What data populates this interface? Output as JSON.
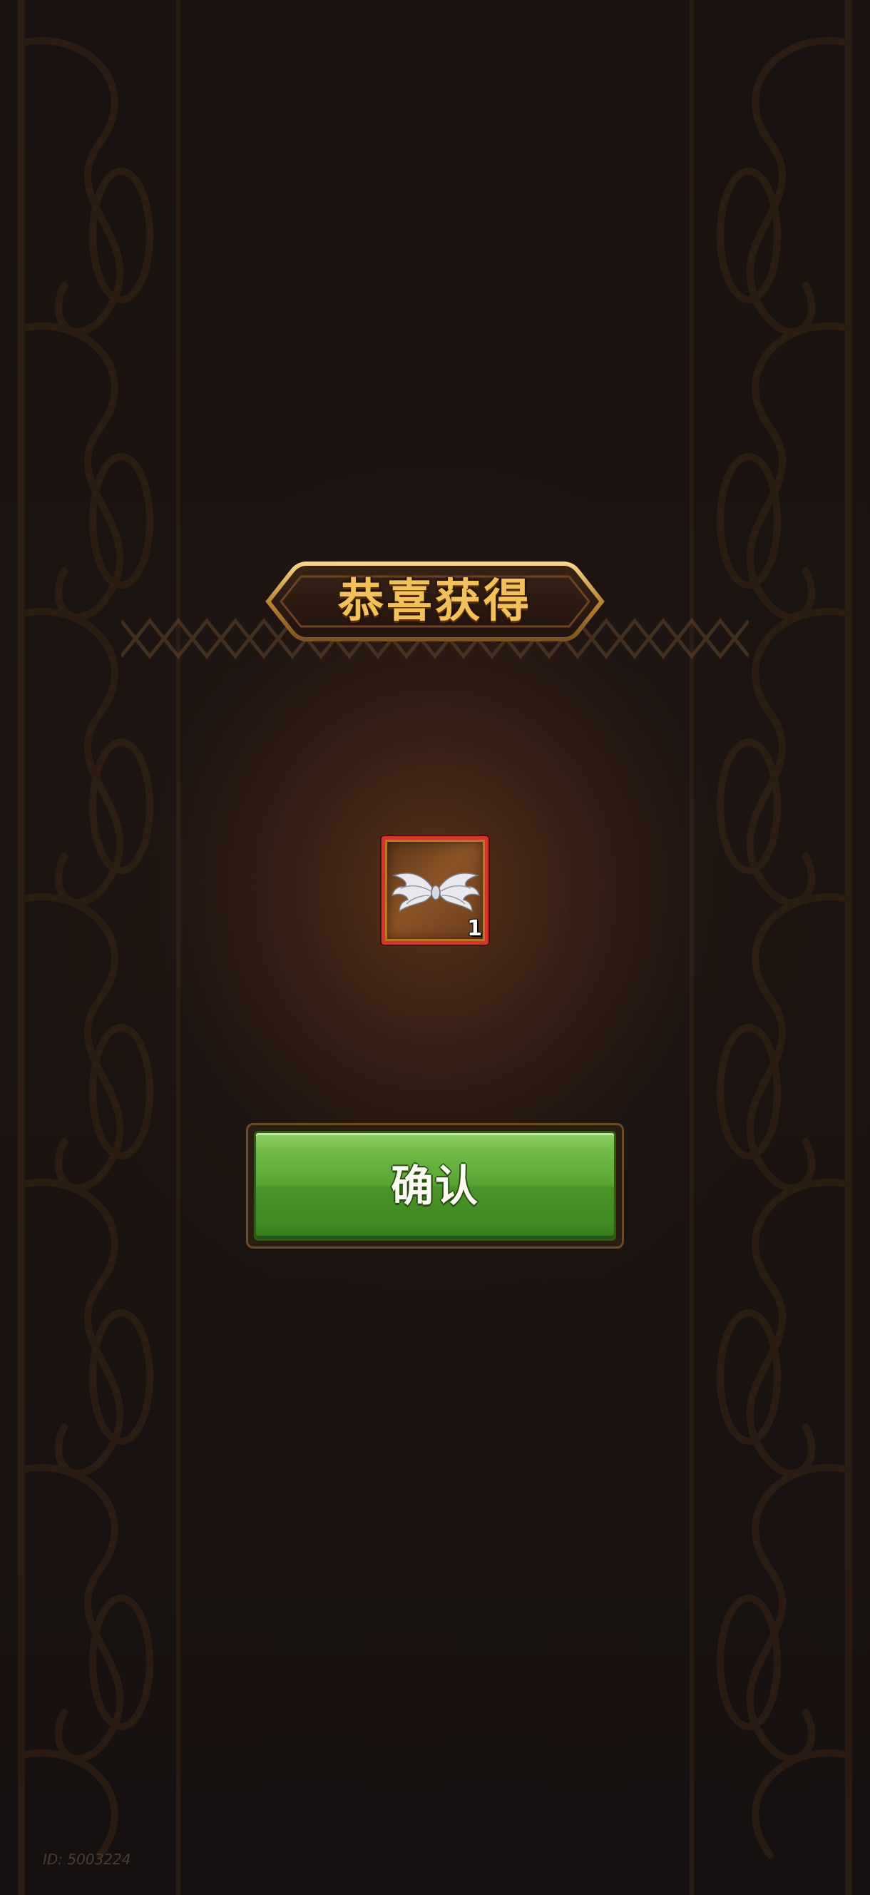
{
  "dialog": {
    "title": "恭喜获得",
    "confirm_label": "确认"
  },
  "reward": {
    "item_icon": "silver-wings-icon",
    "quantity": "1",
    "frame_color": "#d8352a"
  },
  "footer": {
    "player_id": "ID: 5003224"
  },
  "colors": {
    "background": "#1a1210",
    "title_gold": "#f2c15a",
    "button_green": "#5aa634"
  }
}
